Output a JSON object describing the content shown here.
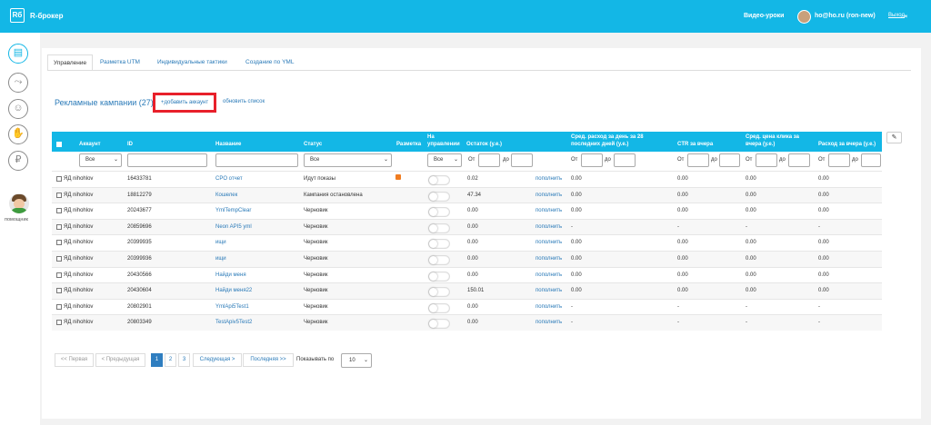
{
  "app": {
    "logo": "Rб",
    "title": "R-брокер"
  },
  "header": {
    "video_link": "Видео-уроки",
    "user": "ho@ho.ru (ron-new)",
    "logout": "Выход"
  },
  "sidebar": {
    "help_label": "помощник",
    "icons": [
      "table-icon",
      "chart-icon",
      "user-icon",
      "thumbs-up-icon",
      "ruble-icon"
    ]
  },
  "tabs": [
    "Управление",
    "Разметка UTM",
    "Индивидуальные тактики",
    "Создание по YML"
  ],
  "section": {
    "title": "Рекламные кампании (27)",
    "add_account": "+добавить аккаунт",
    "refresh": "обновить список"
  },
  "columns": {
    "account": "Аккаунт",
    "id": "ID",
    "name": "Название",
    "status": "Статус",
    "markup": "Разметка",
    "managed_1": "На",
    "managed_2": "управлении",
    "balance": "Остаток (у.е.)",
    "avg_spend_1": "Сред. расход за день за 28",
    "avg_spend_2": "последних дней (у.е.)",
    "ctr": "CTR за вчера",
    "avg_cpc_1": "Сред. цена клика за",
    "avg_cpc_2": "вчера (у.е.)",
    "spend_1": "Расход за вчера (у.е.)"
  },
  "filters": {
    "account": "Все",
    "status": "Все",
    "managed": "Все",
    "from": "От",
    "to": "до"
  },
  "rows": [
    {
      "account": "ЯД  nihohlov",
      "id": "16433781",
      "name": "CPO отчет",
      "status": "Идут показы",
      "markup": true,
      "balance": "0.02",
      "topup": "пополнить",
      "avg_spend": "0.00",
      "ctr": "0.00",
      "cpc": "0.00",
      "spend": "0.00"
    },
    {
      "account": "ЯД  nihohlov",
      "id": "18812279",
      "name": "Кошелек",
      "status": "Кампания остановлена",
      "markup": false,
      "balance": "47.34",
      "topup": "пополнить",
      "avg_spend": "0.00",
      "ctr": "0.00",
      "cpc": "0.00",
      "spend": "0.00"
    },
    {
      "account": "ЯД  nihohlov",
      "id": "20243677",
      "name": "YmlTempClear",
      "status": "Черновик",
      "markup": false,
      "balance": "0.00",
      "topup": "пополнить",
      "avg_spend": "0.00",
      "ctr": "0.00",
      "cpc": "0.00",
      "spend": "0.00"
    },
    {
      "account": "ЯД  nihohlov",
      "id": "20859696",
      "name": "Neon API5 yml",
      "status": "Черновик",
      "markup": false,
      "balance": "0.00",
      "topup": "пополнить",
      "avg_spend": "-",
      "ctr": "-",
      "cpc": "-",
      "spend": "-"
    },
    {
      "account": "ЯД  nihohlov",
      "id": "20399935",
      "name": "ищи",
      "status": "Черновик",
      "markup": false,
      "balance": "0.00",
      "topup": "пополнить",
      "avg_spend": "0.00",
      "ctr": "0.00",
      "cpc": "0.00",
      "spend": "0.00"
    },
    {
      "account": "ЯД  nihohlov",
      "id": "20399936",
      "name": "ищи",
      "status": "Черновик",
      "markup": false,
      "balance": "0.00",
      "topup": "пополнить",
      "avg_spend": "0.00",
      "ctr": "0.00",
      "cpc": "0.00",
      "spend": "0.00"
    },
    {
      "account": "ЯД  nihohlov",
      "id": "20430566",
      "name": "Найди меня",
      "status": "Черновик",
      "markup": false,
      "balance": "0.00",
      "topup": "пополнить",
      "avg_spend": "0.00",
      "ctr": "0.00",
      "cpc": "0.00",
      "spend": "0.00"
    },
    {
      "account": "ЯД  nihohlov",
      "id": "20430604",
      "name": "Найди меня22",
      "status": "Черновик",
      "markup": false,
      "balance": "150.01",
      "topup": "пополнить",
      "avg_spend": "0.00",
      "ctr": "0.00",
      "cpc": "0.00",
      "spend": "0.00"
    },
    {
      "account": "ЯД  nihohlov",
      "id": "20802901",
      "name": "YmlApi5Test1",
      "status": "Черновик",
      "markup": false,
      "balance": "0.00",
      "topup": "пополнить",
      "avg_spend": "-",
      "ctr": "-",
      "cpc": "-",
      "spend": "-"
    },
    {
      "account": "ЯД  nihohlov",
      "id": "20803349",
      "name": "TestApiv5Test2",
      "status": "Черновик",
      "markup": false,
      "balance": "0.00",
      "topup": "пополнить",
      "avg_spend": "-",
      "ctr": "-",
      "cpc": "-",
      "spend": "-"
    }
  ],
  "pagination": {
    "first": "<< Первая",
    "prev": "< Предыдущая",
    "pages": [
      "1",
      "2",
      "3"
    ],
    "current": "1",
    "next": "Следующая >",
    "last": "Последняя >>",
    "show_label": "Показывать по",
    "per_page": "10"
  }
}
